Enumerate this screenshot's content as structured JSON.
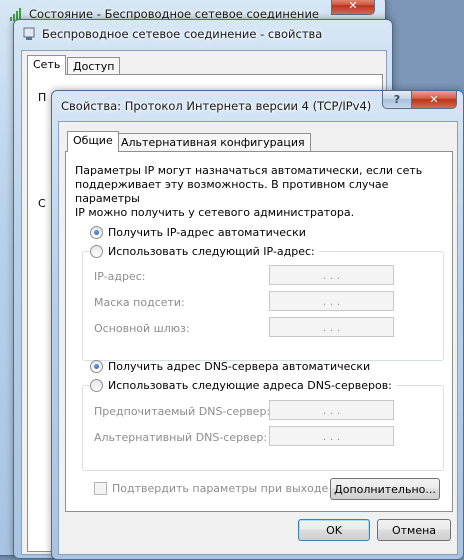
{
  "status_window": {
    "title": "Состояние - Беспроводное сетевое соединение"
  },
  "props_window": {
    "title": "Беспроводное сетевое соединение - свойства",
    "tabs": [
      "Сеть",
      "Доступ"
    ],
    "partial_labels": [
      "П",
      "С"
    ]
  },
  "ipv4_dialog": {
    "title": "Свойства: Протокол Интернета версии 4 (TCP/IPv4)",
    "help_glyph": "?",
    "close_glyph": "✕",
    "tabs": [
      "Общие",
      "Альтернативная конфигурация"
    ],
    "description": [
      "Параметры IP могут назначаться автоматически, если сеть",
      "поддерживает эту возможность. В противном случае параметры",
      "IP можно получить у сетевого администратора."
    ],
    "ip_auto_label": "Получить IP-адрес автоматически",
    "ip_manual_label": "Использовать следующий IP-адрес:",
    "ip_fields": [
      {
        "label": "IP-адрес:",
        "value": ".     .     ."
      },
      {
        "label": "Маска подсети:",
        "value": ".     .     ."
      },
      {
        "label": "Основной шлюз:",
        "value": ".     .     ."
      }
    ],
    "dns_auto_label": "Получить адрес DNS-сервера автоматически",
    "dns_manual_label": "Использовать следующие адреса DNS-серверов:",
    "dns_fields": [
      {
        "label": "Предпочитаемый DNS-сервер:",
        "value": ".     .     ."
      },
      {
        "label": "Альтернативный DNS-сервер:",
        "value": ".     .     ."
      }
    ],
    "validate_label": "Подтвердить параметры при выходе",
    "advanced_button": "Дополнительно...",
    "ok_button": "OK",
    "cancel_button": "Отмена",
    "selected": {
      "ip_mode": "auto",
      "dns_mode": "auto",
      "validate_on_exit": false
    }
  },
  "colors": {
    "accent_titlebar": "#b9d1ea",
    "dialog_face": "#f0f0f0",
    "disabled_text": "#8d8d8d"
  }
}
